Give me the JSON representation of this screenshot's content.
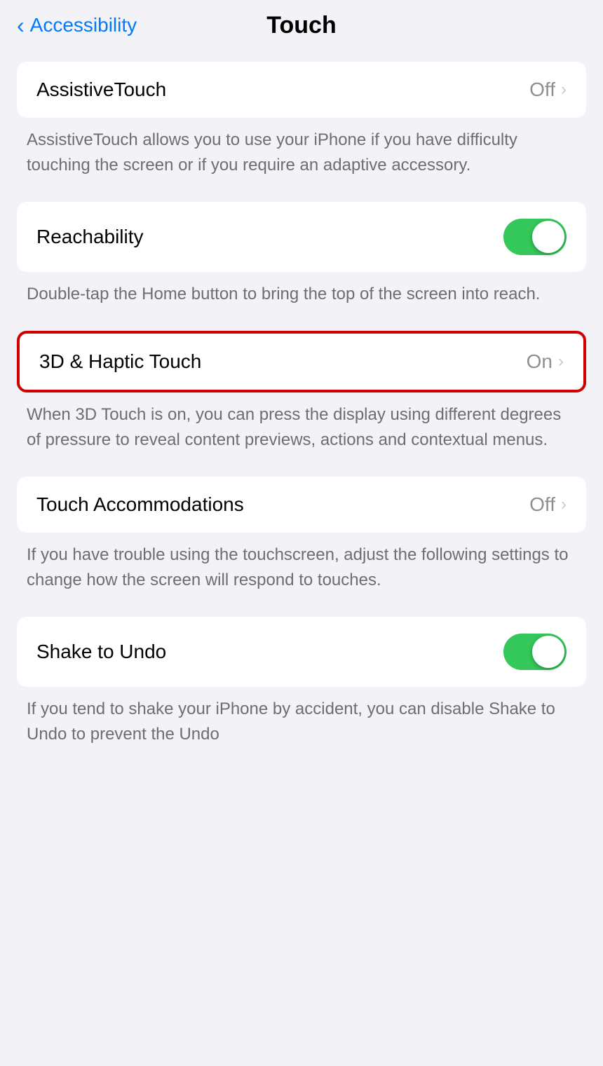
{
  "header": {
    "back_label": "Accessibility",
    "title": "Touch"
  },
  "items": [
    {
      "id": "assistivetouch",
      "label": "AssistiveTouch",
      "value": "Off",
      "has_chevron": true,
      "has_toggle": false,
      "toggle_on": false,
      "highlighted": false,
      "description": "AssistiveTouch allows you to use your iPhone if you have difficulty touching the screen or if you require an adaptive accessory."
    },
    {
      "id": "reachability",
      "label": "Reachability",
      "value": "",
      "has_chevron": false,
      "has_toggle": true,
      "toggle_on": true,
      "highlighted": false,
      "description": "Double-tap the Home button to bring the top of the screen into reach."
    },
    {
      "id": "3d-haptic-touch",
      "label": "3D & Haptic Touch",
      "value": "On",
      "has_chevron": true,
      "has_toggle": false,
      "toggle_on": false,
      "highlighted": true,
      "description": "When 3D Touch is on, you can press the display using different degrees of pressure to reveal content previews, actions and contextual menus."
    },
    {
      "id": "touch-accommodations",
      "label": "Touch Accommodations",
      "value": "Off",
      "has_chevron": true,
      "has_toggle": false,
      "toggle_on": false,
      "highlighted": false,
      "description": "If you have trouble using the touchscreen, adjust the following settings to change how the screen will respond to touches."
    },
    {
      "id": "shake-to-undo",
      "label": "Shake to Undo",
      "value": "",
      "has_chevron": false,
      "has_toggle": true,
      "toggle_on": true,
      "highlighted": false,
      "description": "If you tend to shake your iPhone by accident, you can disable Shake to Undo to prevent the Undo"
    }
  ]
}
